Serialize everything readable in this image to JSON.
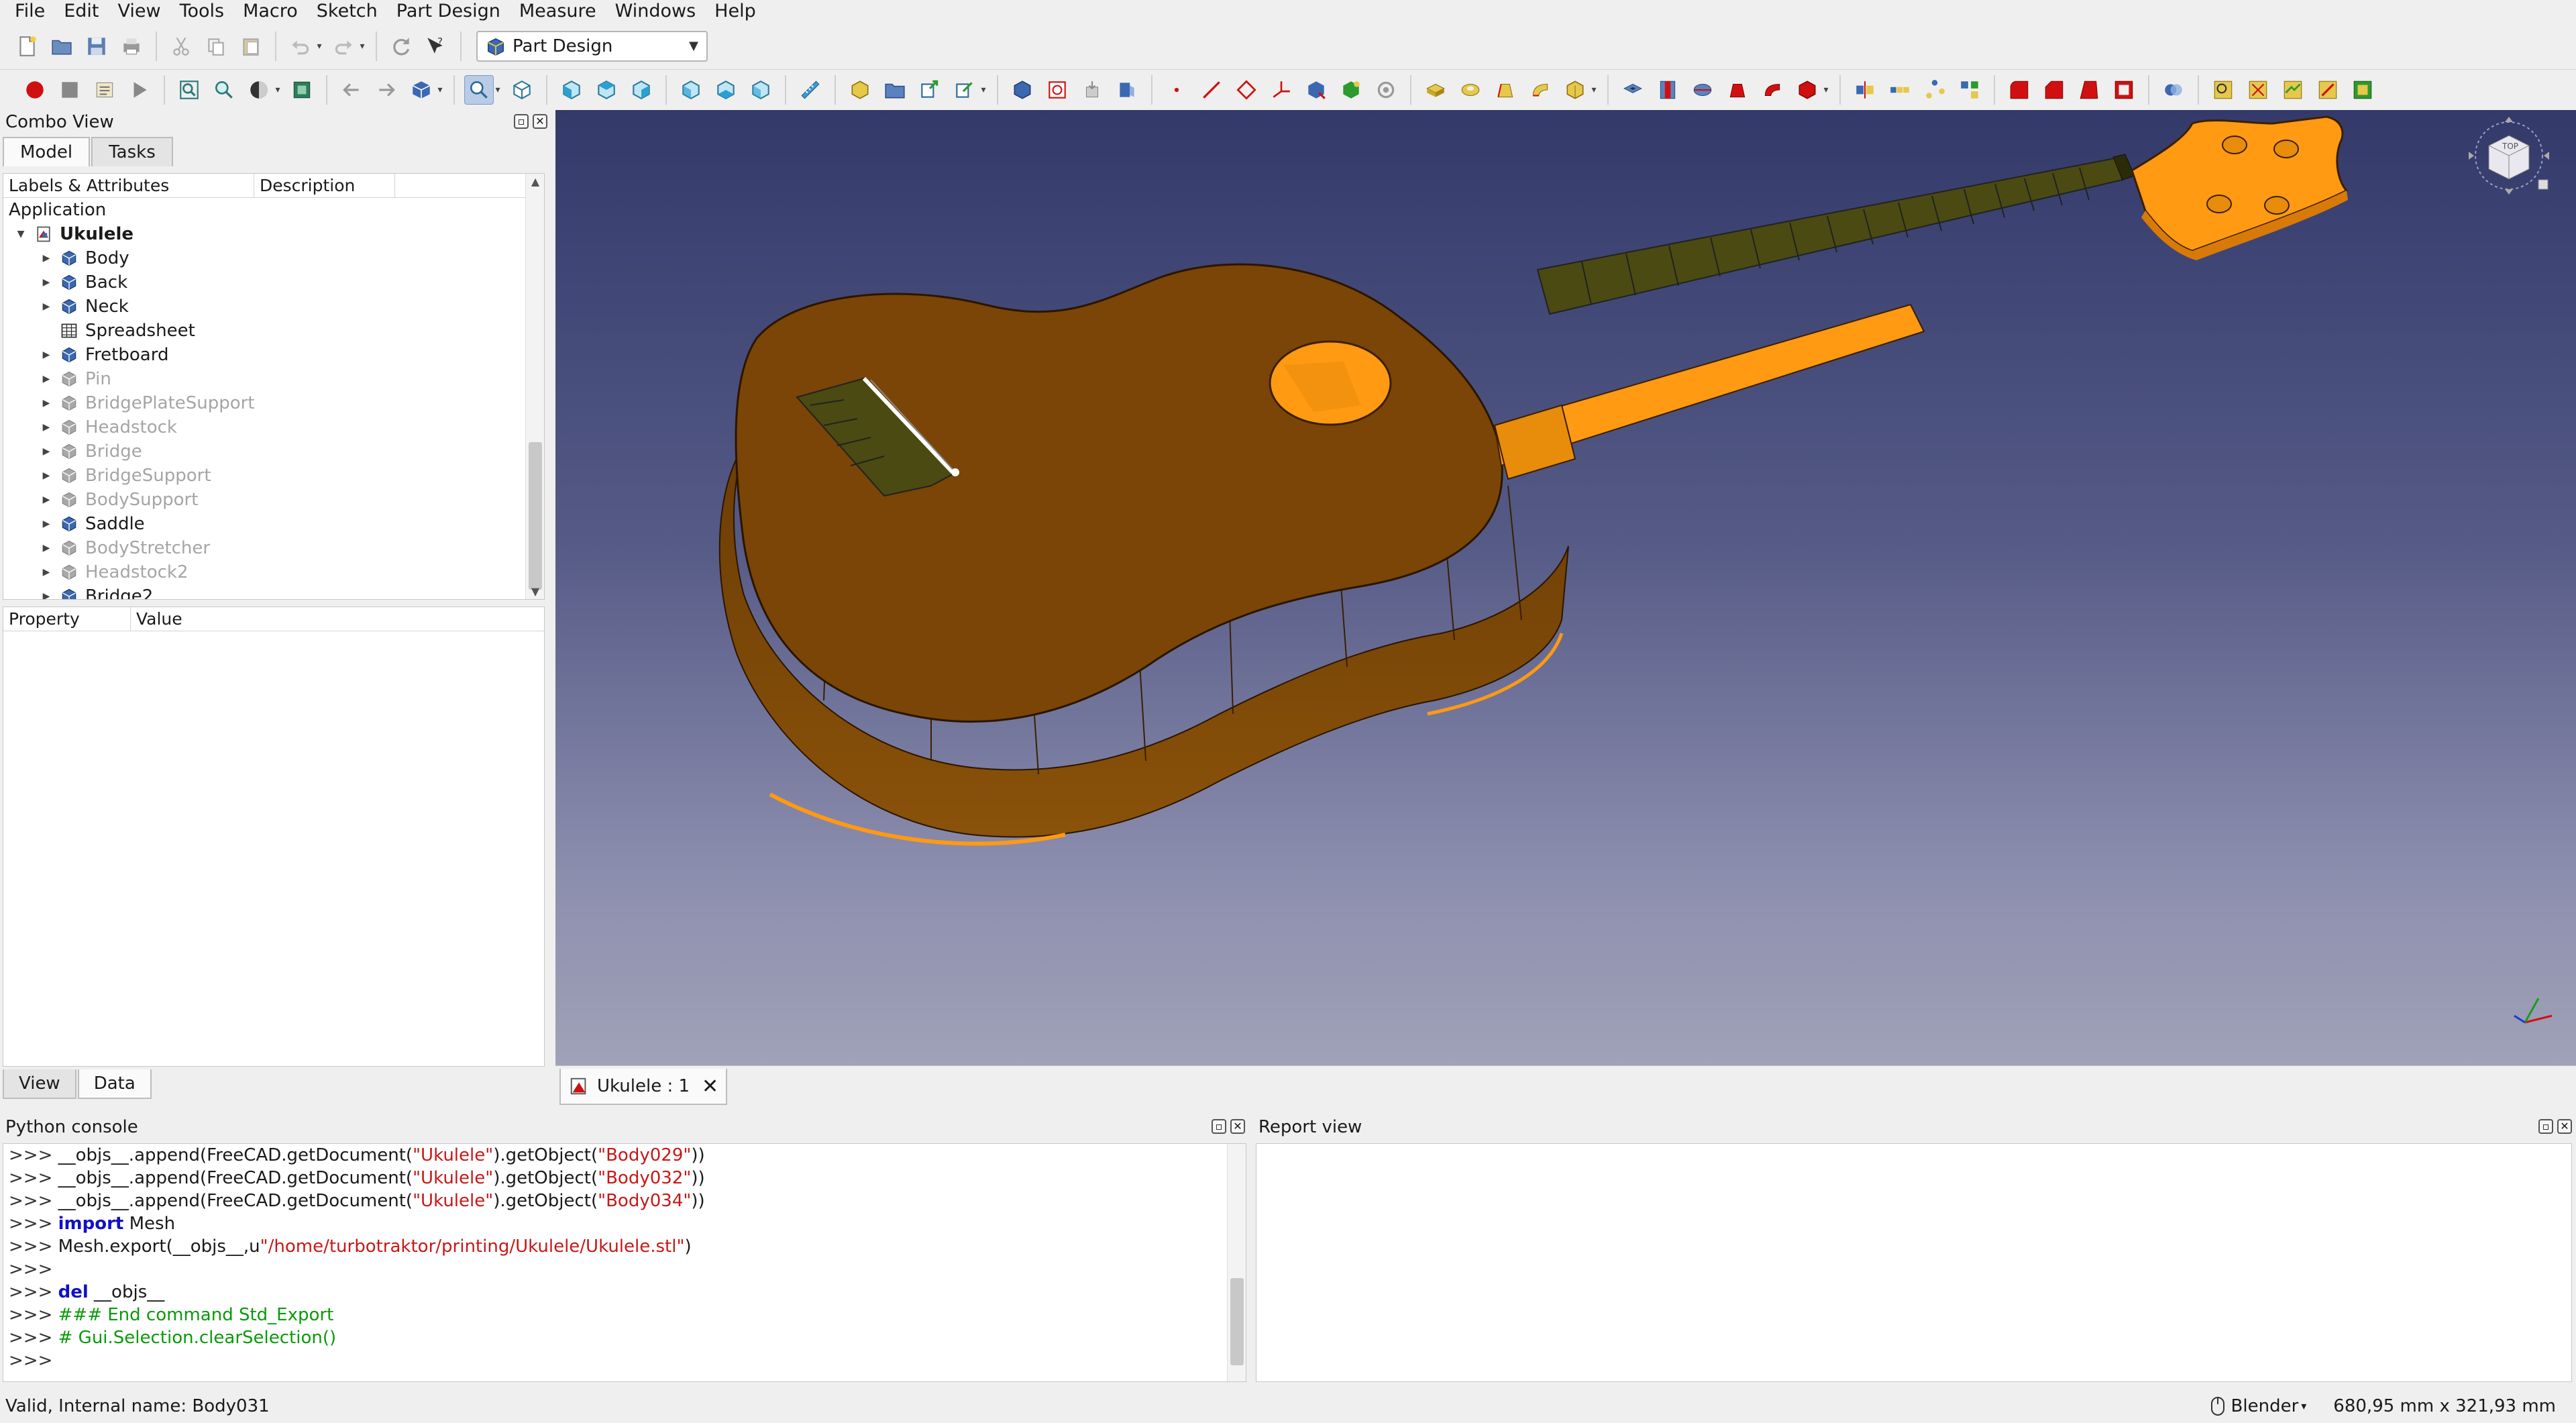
{
  "menubar": {
    "items": [
      "File",
      "Edit",
      "View",
      "Tools",
      "Macro",
      "Sketch",
      "Part Design",
      "Measure",
      "Windows",
      "Help"
    ]
  },
  "toolbar": {
    "workbench": "Part Design"
  },
  "combo_view": {
    "title": "Combo View",
    "tabs": [
      "Model",
      "Tasks"
    ],
    "active_tab": "Model",
    "tree_headers": [
      "Labels & Attributes",
      "Description"
    ],
    "application_label": "Application",
    "document": "Ukulele",
    "items": [
      {
        "label": "Body",
        "enabled": true,
        "expandable": true,
        "icon": "body-icon"
      },
      {
        "label": "Back",
        "enabled": true,
        "expandable": true,
        "icon": "body-icon"
      },
      {
        "label": "Neck",
        "enabled": true,
        "expandable": true,
        "icon": "body-icon"
      },
      {
        "label": "Spreadsheet",
        "enabled": true,
        "expandable": false,
        "icon": "spreadsheet-icon"
      },
      {
        "label": "Fretboard",
        "enabled": true,
        "expandable": true,
        "icon": "body-icon"
      },
      {
        "label": "Pin",
        "enabled": false,
        "expandable": true,
        "icon": "body-icon"
      },
      {
        "label": "BridgePlateSupport",
        "enabled": false,
        "expandable": true,
        "icon": "body-icon"
      },
      {
        "label": "Headstock",
        "enabled": false,
        "expandable": true,
        "icon": "body-icon"
      },
      {
        "label": "Bridge",
        "enabled": false,
        "expandable": true,
        "icon": "body-icon"
      },
      {
        "label": "BridgeSupport",
        "enabled": false,
        "expandable": true,
        "icon": "body-icon"
      },
      {
        "label": "BodySupport",
        "enabled": false,
        "expandable": true,
        "icon": "body-icon"
      },
      {
        "label": "Saddle",
        "enabled": true,
        "expandable": true,
        "icon": "body-icon"
      },
      {
        "label": "BodyStretcher",
        "enabled": false,
        "expandable": true,
        "icon": "body-icon"
      },
      {
        "label": "Headstock2",
        "enabled": false,
        "expandable": true,
        "icon": "body-icon"
      },
      {
        "label": "Bridge2",
        "enabled": true,
        "expandable": true,
        "icon": "body-icon"
      }
    ],
    "property_headers": [
      "Property",
      "Value"
    ],
    "property_tabs": [
      "View",
      "Data"
    ],
    "active_property_tab": "Data"
  },
  "document_tab": {
    "label": "Ukulele : 1"
  },
  "python_console": {
    "title": "Python console",
    "lines": [
      [
        {
          "t": "prompt",
          "v": ">>> "
        },
        {
          "t": "plain",
          "v": "__objs__.append(FreeCAD.getDocument("
        },
        {
          "t": "str",
          "v": "\"Ukulele\""
        },
        {
          "t": "plain",
          "v": ").getObject("
        },
        {
          "t": "str",
          "v": "\"Body029\""
        },
        {
          "t": "plain",
          "v": "))"
        }
      ],
      [
        {
          "t": "prompt",
          "v": ">>> "
        },
        {
          "t": "plain",
          "v": "__objs__.append(FreeCAD.getDocument("
        },
        {
          "t": "str",
          "v": "\"Ukulele\""
        },
        {
          "t": "plain",
          "v": ").getObject("
        },
        {
          "t": "str",
          "v": "\"Body032\""
        },
        {
          "t": "plain",
          "v": "))"
        }
      ],
      [
        {
          "t": "prompt",
          "v": ">>> "
        },
        {
          "t": "plain",
          "v": "__objs__.append(FreeCAD.getDocument("
        },
        {
          "t": "str",
          "v": "\"Ukulele\""
        },
        {
          "t": "plain",
          "v": ").getObject("
        },
        {
          "t": "str",
          "v": "\"Body034\""
        },
        {
          "t": "plain",
          "v": "))"
        }
      ],
      [
        {
          "t": "prompt",
          "v": ">>> "
        },
        {
          "t": "kw",
          "v": "import"
        },
        {
          "t": "plain",
          "v": " Mesh"
        }
      ],
      [
        {
          "t": "prompt",
          "v": ">>> "
        },
        {
          "t": "plain",
          "v": "Mesh.export(__objs__,u"
        },
        {
          "t": "str",
          "v": "\"/home/turbotraktor/printing/Ukulele/Ukulele.stl\""
        },
        {
          "t": "plain",
          "v": ")"
        }
      ],
      [
        {
          "t": "prompt",
          "v": ">>> "
        }
      ],
      [
        {
          "t": "prompt",
          "v": ">>> "
        },
        {
          "t": "kw",
          "v": "del"
        },
        {
          "t": "plain",
          "v": " __objs__"
        }
      ],
      [
        {
          "t": "prompt",
          "v": ">>> "
        },
        {
          "t": "cmt",
          "v": "### End command Std_Export"
        }
      ],
      [
        {
          "t": "prompt",
          "v": ">>> "
        },
        {
          "t": "cmt",
          "v": "# Gui.Selection.clearSelection()"
        }
      ],
      [
        {
          "t": "prompt",
          "v": ">>> "
        }
      ]
    ]
  },
  "report_view": {
    "title": "Report view"
  },
  "statusbar": {
    "message": "Valid, Internal name: Body031",
    "navigation_style": "Blender",
    "dimensions": "680,95 mm x 321,93 mm"
  },
  "colors": {
    "viewport_top": "#333a6a",
    "viewport_bottom": "#a0a2b8",
    "ukulele_body": "#8a4e06",
    "ukulele_highlight": "#ff9a12",
    "fretboard": "#4a4a12",
    "record_button": "#d01010"
  }
}
